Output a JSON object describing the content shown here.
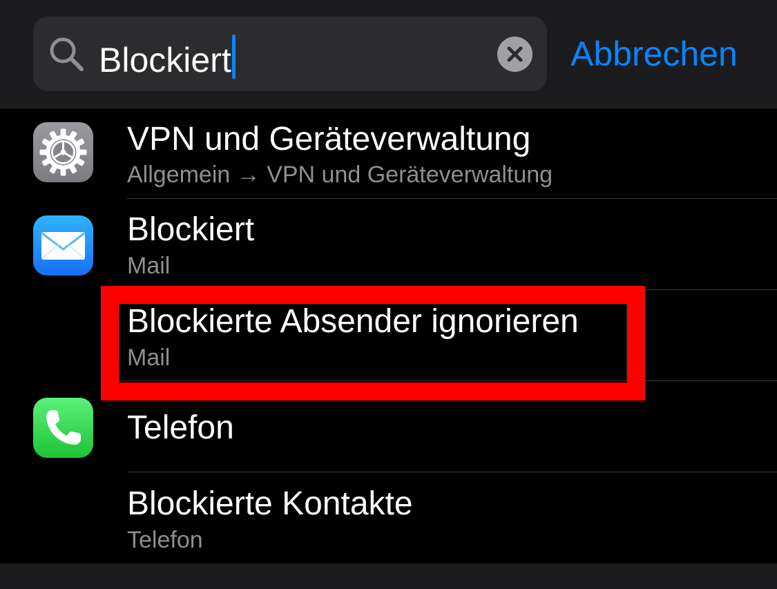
{
  "search": {
    "query": "Blockiert",
    "cancel_label": "Abbrechen",
    "icon": "search-icon",
    "clear_icon": "clear-icon"
  },
  "results": [
    {
      "title": "VPN und Geräteverwaltung",
      "subtitle": "Allgemein → VPN und Geräteverwaltung",
      "icon": "settings-gear-icon"
    },
    {
      "title": "Blockiert",
      "subtitle": "Mail",
      "icon": "mail-envelope-icon"
    },
    {
      "title": "Blockierte Absender ignorieren",
      "subtitle": "Mail",
      "highlighted": true
    },
    {
      "title": "Telefon",
      "icon": "phone-handset-icon"
    },
    {
      "title": "Blockierte Kontakte",
      "subtitle": "Telefon"
    }
  ],
  "colors": {
    "accent": "#0a84ff",
    "highlight": "#ff0000",
    "background": "#000000",
    "header": "#1c1c1e",
    "secondary_text": "#8e8e93"
  }
}
